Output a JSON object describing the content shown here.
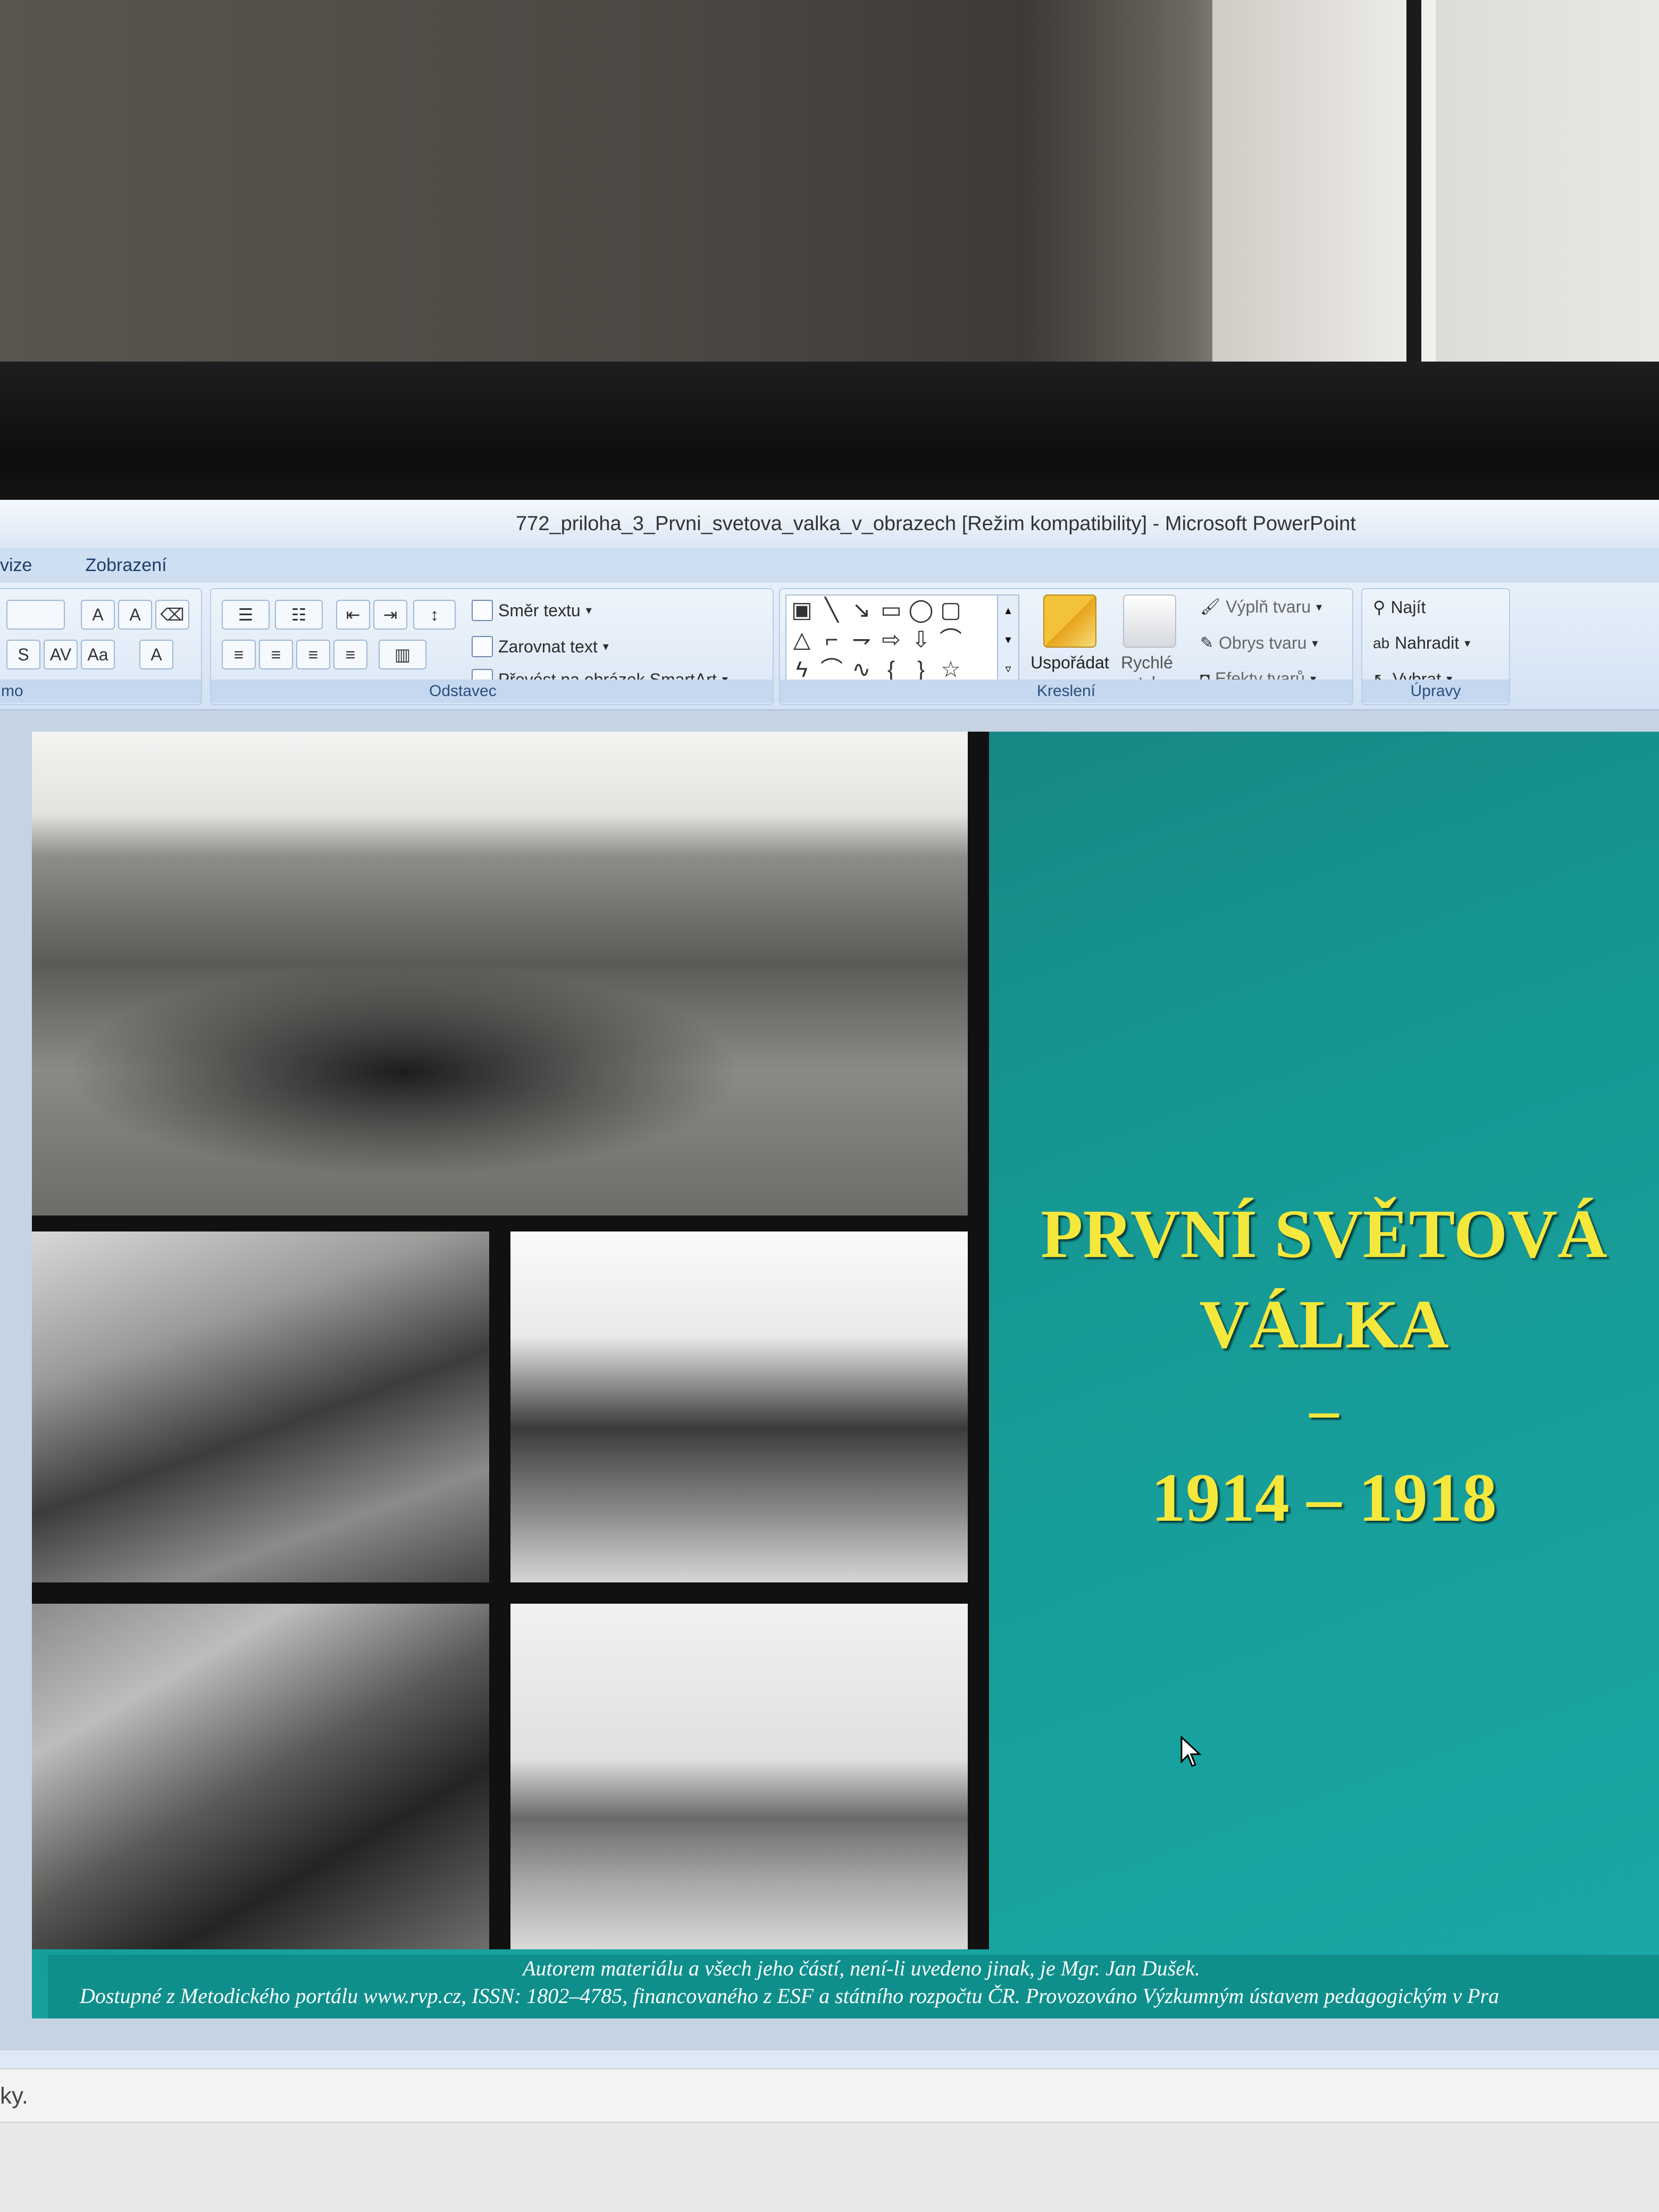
{
  "window": {
    "title": "772_priloha_3_Prvni_svetova_valka_v_obrazech [Režim kompatibility] - Microsoft PowerPoint"
  },
  "menu": {
    "tabs": [
      "vize",
      "Zobrazení"
    ]
  },
  "ribbon": {
    "font_group_label": "mo",
    "paragraph": {
      "label": "Odstavec",
      "text_direction": "Směr textu",
      "align_text": "Zarovnat text",
      "smartart": "Převést na obrázek SmartArt"
    },
    "drawing": {
      "label": "Kreslení",
      "arrange": "Uspořádat",
      "quick_styles_1": "Rychlé",
      "quick_styles_2": "styly",
      "shape_fill": "Výplň tvaru",
      "shape_outline": "Obrys tvaru",
      "shape_effects": "Efekty tvarů"
    },
    "editing": {
      "label": "Úpravy",
      "find": "Najít",
      "replace": "Nahradit",
      "select": "Vybrat"
    }
  },
  "slide": {
    "title_line1": "PRVNÍ SVĚTOVÁ",
    "title_line2": "VÁLKA",
    "title_dash": "–",
    "title_years": "1914 – 1918",
    "footer_line1": "Autorem materiálu a všech jeho částí, není-li uvedeno jinak, je Mgr. Jan Dušek.",
    "footer_line2": "Dostupné z Metodického portálu www.rvp.cz, ISSN: 1802–4785, financovaného z ESF a státního rozpočtu ČR. Provozováno Výzkumným ústavem pedagogickým v Pra"
  },
  "status": {
    "text": "ky."
  },
  "colors": {
    "slide_background": "#169894",
    "title_text": "#f4e83d",
    "ribbon": "#dbe7f5"
  }
}
